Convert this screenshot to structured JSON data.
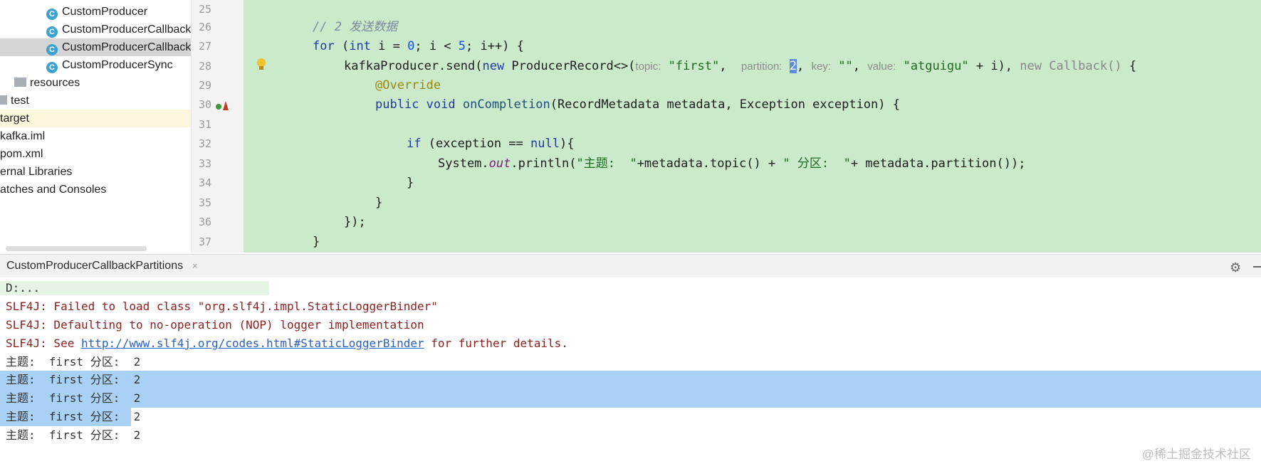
{
  "project_tree": {
    "items": [
      {
        "label": "CustomProducer",
        "type": "class"
      },
      {
        "label": "CustomProducerCallback",
        "type": "class"
      },
      {
        "label": "CustomProducerCallback",
        "type": "class",
        "selected": true
      },
      {
        "label": "CustomProducerSync",
        "type": "class"
      },
      {
        "label": "resources",
        "type": "folder"
      },
      {
        "label": "test",
        "type": "folder"
      },
      {
        "label": "target",
        "type": "folder"
      },
      {
        "label": "kafka.iml",
        "type": "file"
      },
      {
        "label": "pom.xml",
        "type": "file"
      },
      {
        "label": "ernal Libraries",
        "type": "library"
      },
      {
        "label": "atches and Consoles",
        "type": "scratch"
      }
    ]
  },
  "editor": {
    "line_numbers": [
      "25",
      "26",
      "27",
      "28",
      "29",
      "30",
      "31",
      "32",
      "33",
      "34",
      "35",
      "36",
      "37"
    ],
    "lines": {
      "l26": "// 2 发送数据",
      "l27_a": "for",
      "l27_b": " (",
      "l27_c": "int",
      "l27_d": " i = ",
      "l27_e": "0",
      "l27_f": "; i < ",
      "l27_g": "5",
      "l27_h": "; i++) {",
      "l28_a": "kafkaProducer.send(",
      "l28_b": "new",
      "l28_c": " ProducerRecord<>(",
      "l28_hint_topic": "topic:",
      "l28_topic": "\"first\"",
      "l28_comma1": ",",
      "l28_hint_partition": "partition:",
      "l28_partition": "2",
      "l28_comma2": ",",
      "l28_hint_key": "key:",
      "l28_key": "\"\"",
      "l28_comma3": ",",
      "l28_hint_value": "value:",
      "l28_value": "\"atguigu\"",
      "l28_rest1": " + i), ",
      "l28_new_cb": "new Callback()",
      "l28_brace": " {",
      "l29": "@Override",
      "l30_a": "public",
      "l30_b": " ",
      "l30_c": "void",
      "l30_d": " ",
      "l30_e": "onCompletion",
      "l30_f": "(RecordMetadata metadata, Exception exception) {",
      "l32_a": "if",
      "l32_b": " (exception == ",
      "l32_c": "null",
      "l32_d": "){",
      "l33_a": "System.",
      "l33_b": "out",
      "l33_c": ".println(",
      "l33_d": "\"主题:  \"",
      "l33_e": "+metadata.topic() + ",
      "l33_f": "\" 分区:  \"",
      "l33_g": "+ metadata.partition());",
      "l34": "}",
      "l35": "}",
      "l36": "});",
      "l37": "}"
    }
  },
  "console": {
    "tab_label": "CustomProducerCallbackPartitions",
    "close_glyph": "×",
    "settings_glyph": "⚙",
    "lines": {
      "cmd": "D:...",
      "slf1": "SLF4J: Failed to load class \"org.slf4j.impl.StaticLoggerBinder\"",
      "slf2": "SLF4J: Defaulting to no-operation (NOP) logger implementation",
      "slf3_a": "SLF4J: See ",
      "slf3_link": "http://www.slf4j.org/codes.html#StaticLoggerBinder",
      "slf3_b": " for further details.",
      "out1": "主题:  first 分区:  2",
      "out2": "主题:  first 分区:  2",
      "out3": "主题:  first 分区:  2",
      "out4": "主题:  first 分区:  2",
      "out5": "主题:  first 分区:  2"
    }
  },
  "watermark": "@稀土掘金技术社区"
}
